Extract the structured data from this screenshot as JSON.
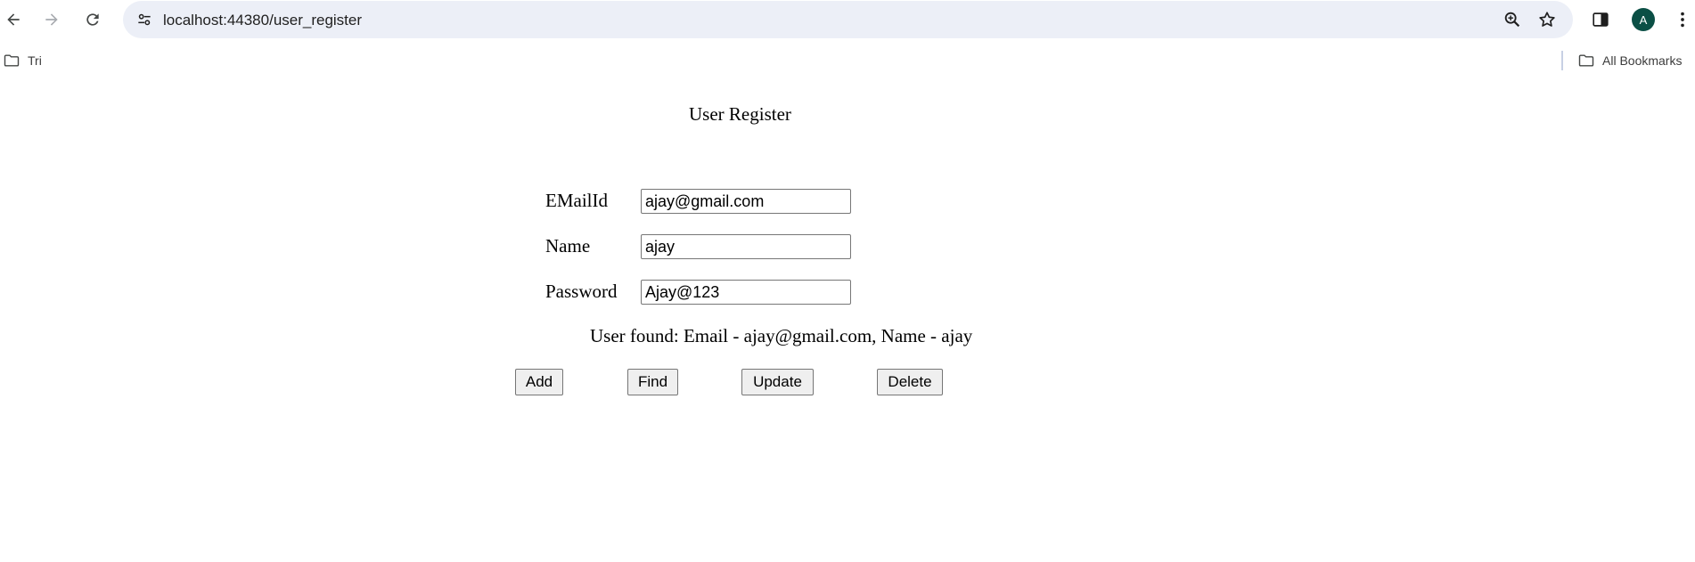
{
  "browser": {
    "url": "localhost:44380/user_register",
    "profile_initial": "A",
    "bookmarks": {
      "left_folder": "Tri",
      "right_folder": "All Bookmarks"
    },
    "icons": {
      "back": "arrow-left-icon",
      "forward": "arrow-right-icon",
      "reload": "reload-icon",
      "site_info": "tune-icon",
      "zoom": "zoom-in-icon",
      "bookmark": "star-icon",
      "side_panel": "side-panel-icon",
      "menu": "kebab-menu-icon",
      "folder": "folder-icon"
    }
  },
  "page": {
    "title": "User Register",
    "fields": {
      "email": {
        "label": "EMailId",
        "value": "ajay@gmail.com"
      },
      "name": {
        "label": "Name",
        "value": "ajay"
      },
      "password": {
        "label": "Password",
        "value": "Ajay@123"
      }
    },
    "status_message": "User found: Email - ajay@gmail.com, Name - ajay",
    "buttons": {
      "add": "Add",
      "find": "Find",
      "update": "Update",
      "delete": "Delete"
    }
  }
}
